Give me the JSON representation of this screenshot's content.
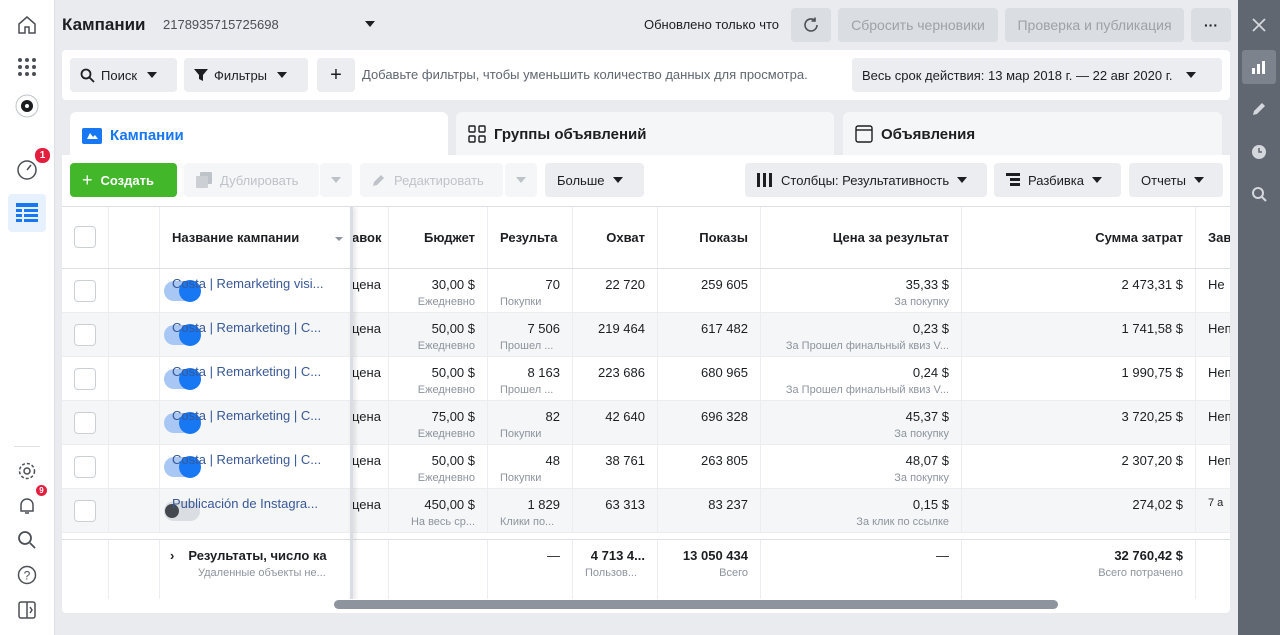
{
  "header": {
    "title": "Кампании",
    "account_id": "2178935715725698",
    "updated": "Обновлено только что",
    "discard_label": "Сбросить черновики",
    "publish_label": "Проверка и публикация",
    "more_label": "···"
  },
  "left_nav": {
    "badge_count": "1",
    "notif_count": "9"
  },
  "filter_bar": {
    "search_label": "Поиск",
    "filters_label": "Фильтры",
    "add_label": "+",
    "hint": "Добавьте фильтры, чтобы уменьшить количество данных для просмотра.",
    "date_range": "Весь срок действия: 13 мар 2018 г. — 22 авг 2020 г."
  },
  "tabs": [
    {
      "label": "Кампании"
    },
    {
      "label": "Группы объявлений"
    },
    {
      "label": "Объявления"
    }
  ],
  "actions": {
    "create": "Создать",
    "duplicate": "Дублировать",
    "edit": "Редактировать",
    "more": "Больше",
    "columns": "Столбцы: Результативность",
    "breakdown": "Разбивка",
    "reports": "Отчеты"
  },
  "columns": {
    "name": "Название кампании",
    "bid": "авок",
    "budget": "Бюджет",
    "results": "Результа",
    "reach": "Охват",
    "impressions": "Показы",
    "cost_per_result": "Цена за результат",
    "amount_spent": "Сумма затрат",
    "ends": "Зав"
  },
  "rows": [
    {
      "name": "Costa | Remarketing visi...",
      "active": true,
      "bid": "цена",
      "budget": "30,00 $",
      "budget_sub": "Ежедневно",
      "results": "70",
      "results_sub": "Покупки",
      "reach": "22 720",
      "impressions": "259 605",
      "cpr": "35,33 $",
      "cpr_sub": "За покупку",
      "spent": "2 473,31 $",
      "ends": "Не"
    },
    {
      "name": "Costa | Remarketing | C...",
      "active": true,
      "bid": "цена",
      "budget": "50,00 $",
      "budget_sub": "Ежедневно",
      "results": "7 506",
      "results_sub": "Прошел ...",
      "reach": "219 464",
      "impressions": "617 482",
      "cpr": "0,23 $",
      "cpr_sub": "За Прошел финальный квиз V...",
      "spent": "1 741,58 $",
      "ends": "Неп"
    },
    {
      "name": "Costa | Remarketing | C...",
      "active": true,
      "bid": "цена",
      "budget": "50,00 $",
      "budget_sub": "Ежедневно",
      "results": "8 163",
      "results_sub": "Прошел ...",
      "reach": "223 686",
      "impressions": "680 965",
      "cpr": "0,24 $",
      "cpr_sub": "За Прошел финальный квиз V...",
      "spent": "1 990,75 $",
      "ends": "Неп"
    },
    {
      "name": "Costa | Remarketing | C...",
      "active": true,
      "bid": "цена",
      "budget": "75,00 $",
      "budget_sub": "Ежедневно",
      "results": "82",
      "results_sub": "Покупки",
      "reach": "42 640",
      "impressions": "696 328",
      "cpr": "45,37 $",
      "cpr_sub": "За покупку",
      "spent": "3 720,25 $",
      "ends": "Неп"
    },
    {
      "name": "Costa | Remarketing | C...",
      "active": true,
      "bid": "цена",
      "budget": "50,00 $",
      "budget_sub": "Ежедневно",
      "results": "48",
      "results_sub": "Покупки",
      "reach": "38 761",
      "impressions": "263 805",
      "cpr": "48,07 $",
      "cpr_sub": "За покупку",
      "spent": "2 307,20 $",
      "ends": "Неп"
    },
    {
      "name": "Publicación de Instagra...",
      "active": false,
      "bid": "цена",
      "budget": "450,00 $",
      "budget_sub": "На весь ср...",
      "results": "1 829",
      "results_sub": "Клики по...",
      "reach": "63 313",
      "impressions": "83 237",
      "cpr": "0,15 $",
      "cpr_sub": "За клик по ссылке",
      "spent": "274,02 $",
      "ends": "7 а"
    }
  ],
  "totals": {
    "label": "Результаты, число ка",
    "sub": "Удаленные объекты не...",
    "results": "—",
    "reach": "4 713 4...",
    "reach_sub": "Пользов...",
    "impressions": "13 050 434",
    "impressions_sub": "Всего",
    "cpr": "—",
    "spent": "32 760,42 $",
    "spent_sub": "Всего потрачено"
  }
}
